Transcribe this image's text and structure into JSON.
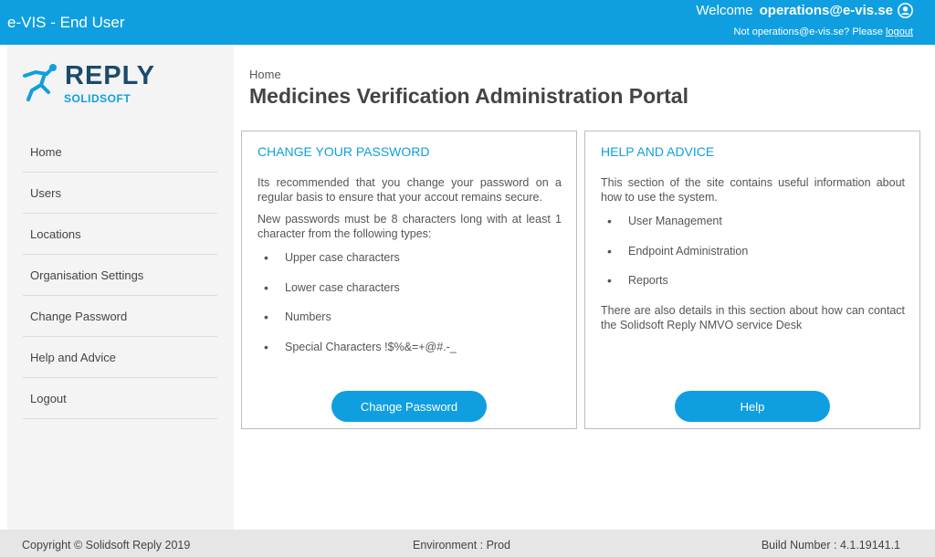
{
  "header": {
    "app_title": "e-VIS - End User",
    "welcome_label": "Welcome",
    "user_email": "operations@e-vis.se",
    "not_user_text": "Not operations@e-vis.se?  Please",
    "logout_link": "logout",
    "bg_color": "#0f9fe0"
  },
  "logo": {
    "brand": "REPLY",
    "sub": "SOLIDSOFT"
  },
  "nav": {
    "items": [
      {
        "label": "Home"
      },
      {
        "label": "Users"
      },
      {
        "label": "Locations"
      },
      {
        "label": "Organisation Settings"
      },
      {
        "label": "Change Password"
      },
      {
        "label": "Help and Advice"
      },
      {
        "label": "Logout"
      }
    ]
  },
  "main": {
    "breadcrumb": "Home",
    "title": "Medicines Verification Administration Portal"
  },
  "password_card": {
    "title": "CHANGE YOUR PASSWORD",
    "intro": "Its recommended that you change your password on a regular basis to ensure that your accout remains secure.",
    "rules": "New passwords must be 8 characters long with at least 1 character from the following types:",
    "items": [
      "Upper case characters",
      "Lower case characters",
      "Numbers",
      "Special Characters !$%&=+@#.-_"
    ],
    "button_label": "Change Password"
  },
  "help_card": {
    "title": "HELP AND ADVICE",
    "intro": "This section of the site contains useful information about how to use the system.",
    "items": [
      "User Management",
      "Endpoint Administration",
      "Reports"
    ],
    "outro": "There are also details in this section about how can contact the Solidsoft Reply NMVO service Desk",
    "button_label": "Help"
  },
  "footer": {
    "copyright": "Copyright © Solidsoft Reply 2019",
    "environment": "Environment : Prod",
    "build": "Build Number : 4.1.19141.1"
  }
}
